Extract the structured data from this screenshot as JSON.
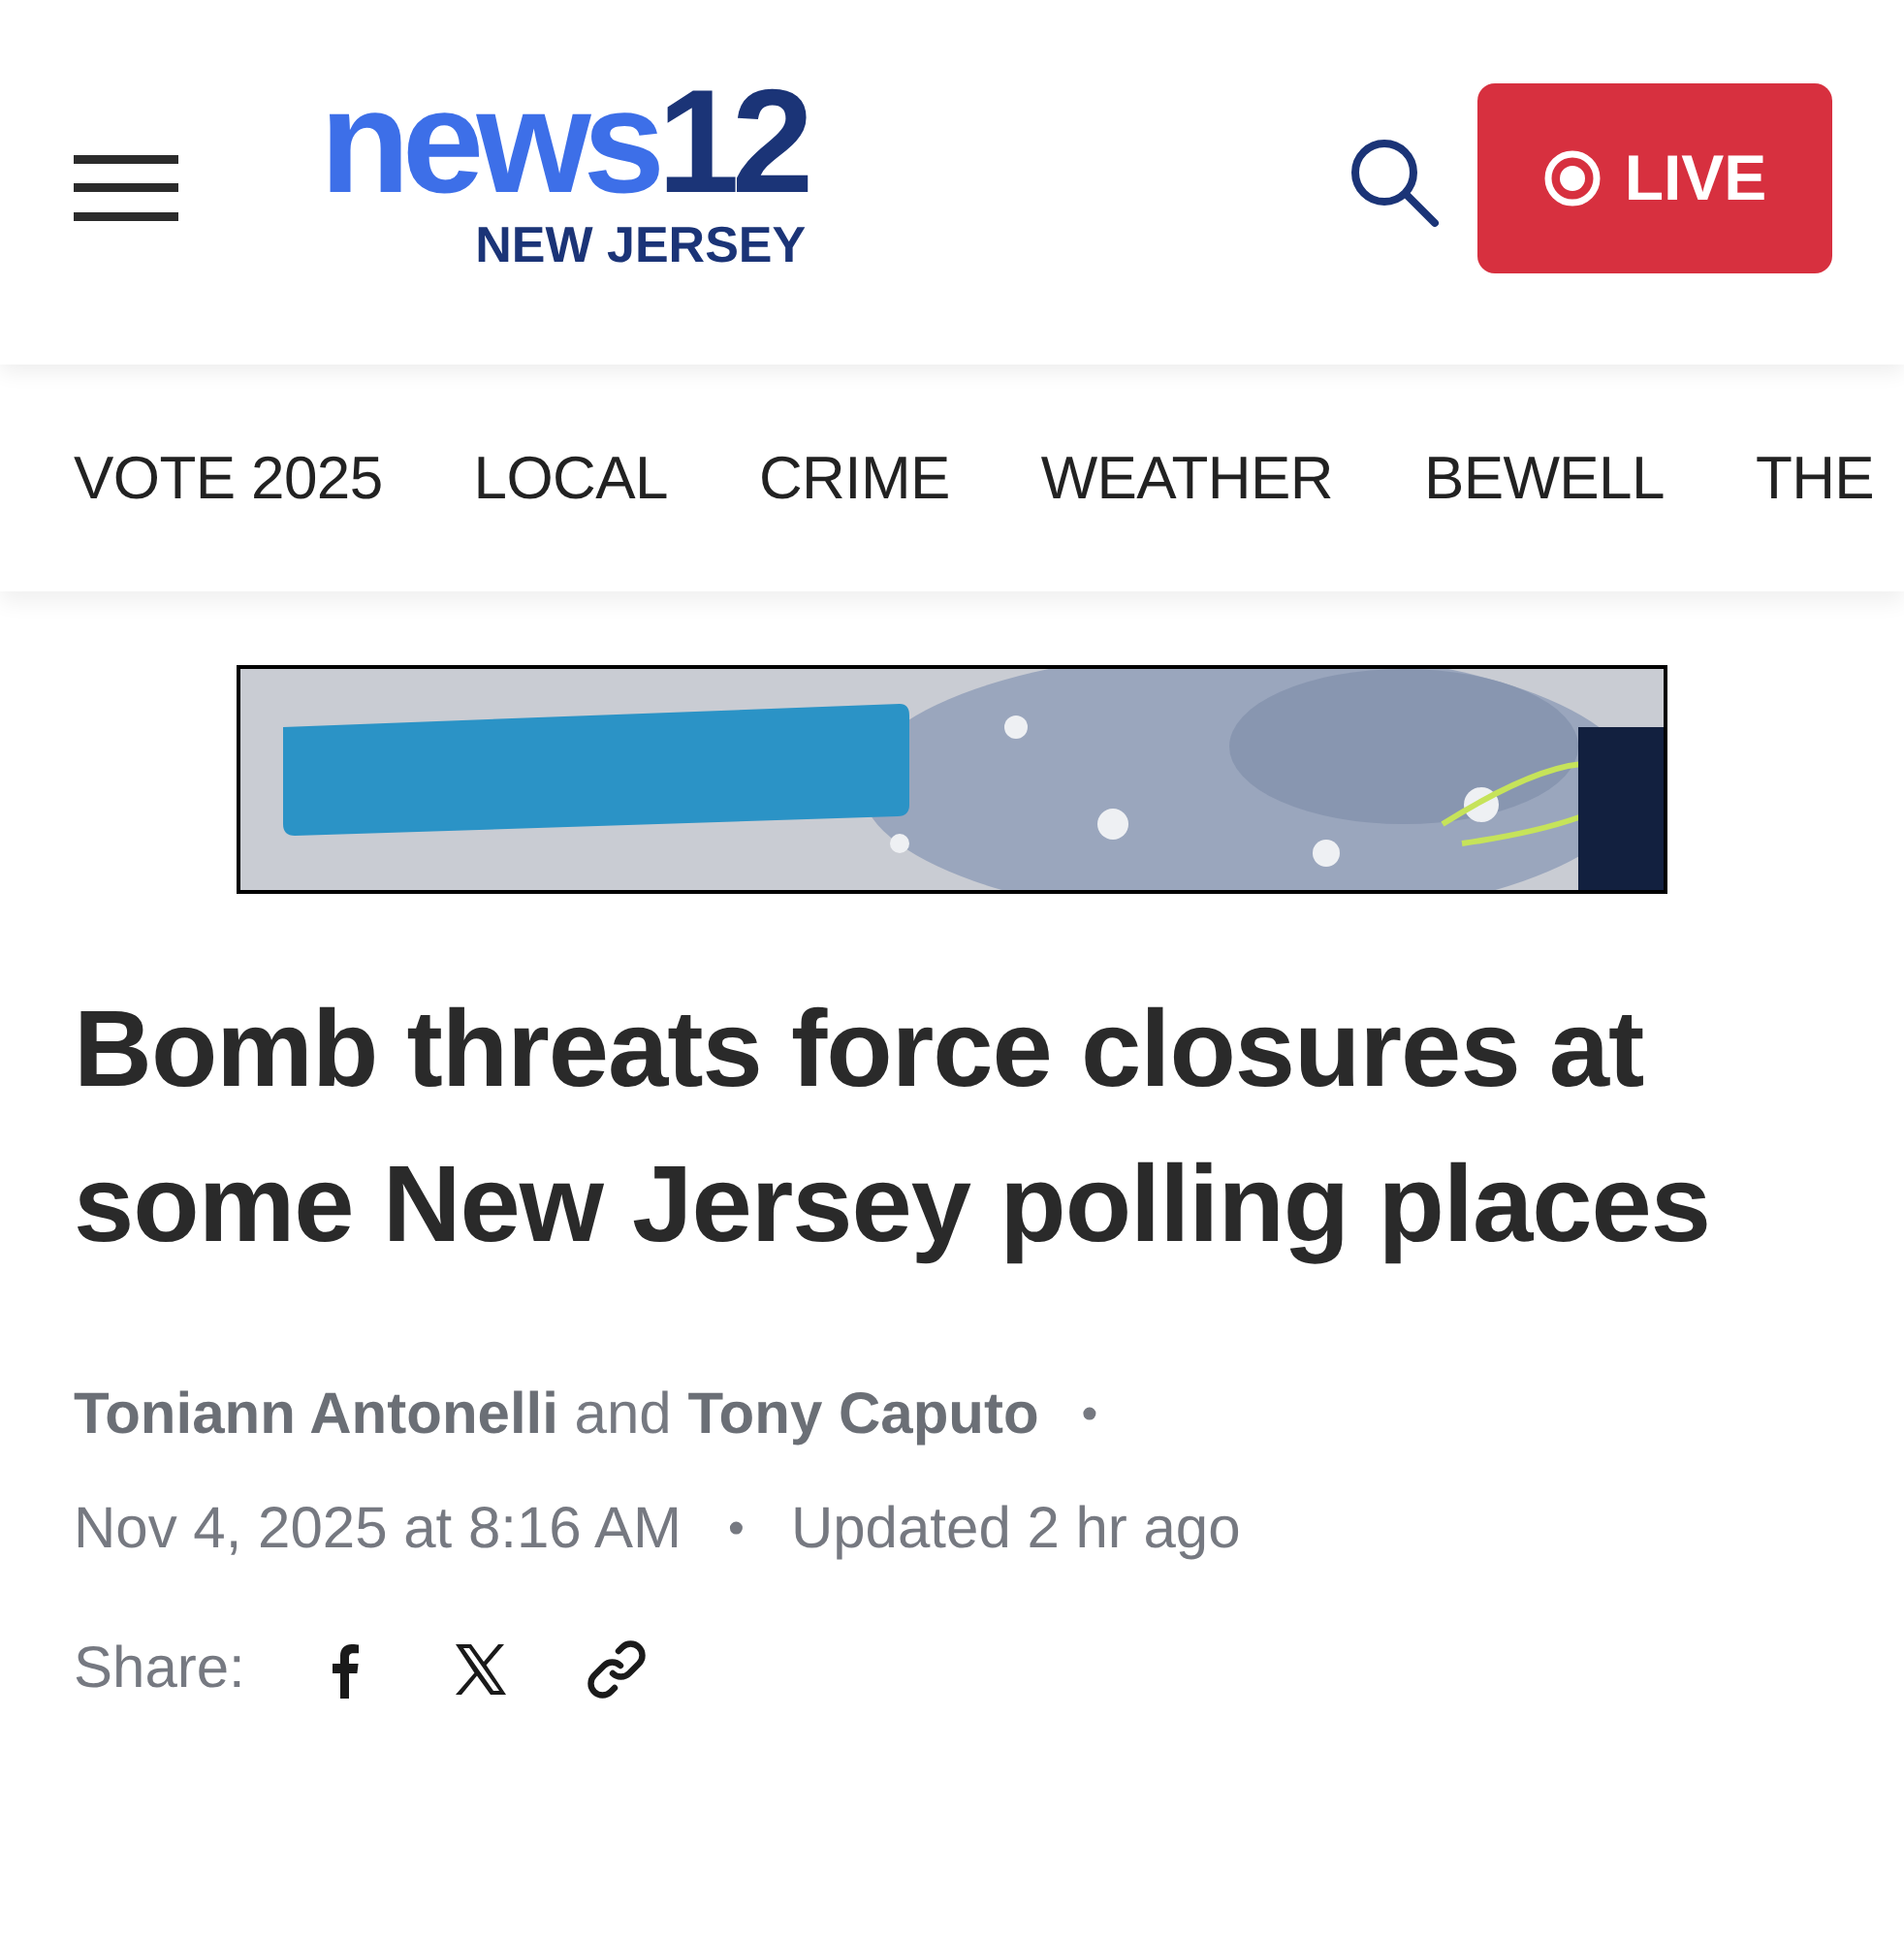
{
  "header": {
    "logo": {
      "word": "news",
      "number": "12",
      "region": "NEW JERSEY"
    },
    "live_button": {
      "label": "LIVE"
    }
  },
  "nav": [
    {
      "label": "VOTE 2025"
    },
    {
      "label": "LOCAL"
    },
    {
      "label": "CRIME"
    },
    {
      "label": "WEATHER"
    },
    {
      "label": "BEWELL"
    },
    {
      "label": "THE"
    }
  ],
  "article": {
    "headline": "Bomb threats force closures at some New Jersey polling places",
    "byline": "**Toniann Antonelli** and **Tony Caputo**",
    "byline_separator": "•",
    "date": "Nov 4, 2025 at 8:16 AM",
    "date_separator": "•",
    "updated": "Updated 2 hr ago",
    "share_label": "Share:"
  }
}
